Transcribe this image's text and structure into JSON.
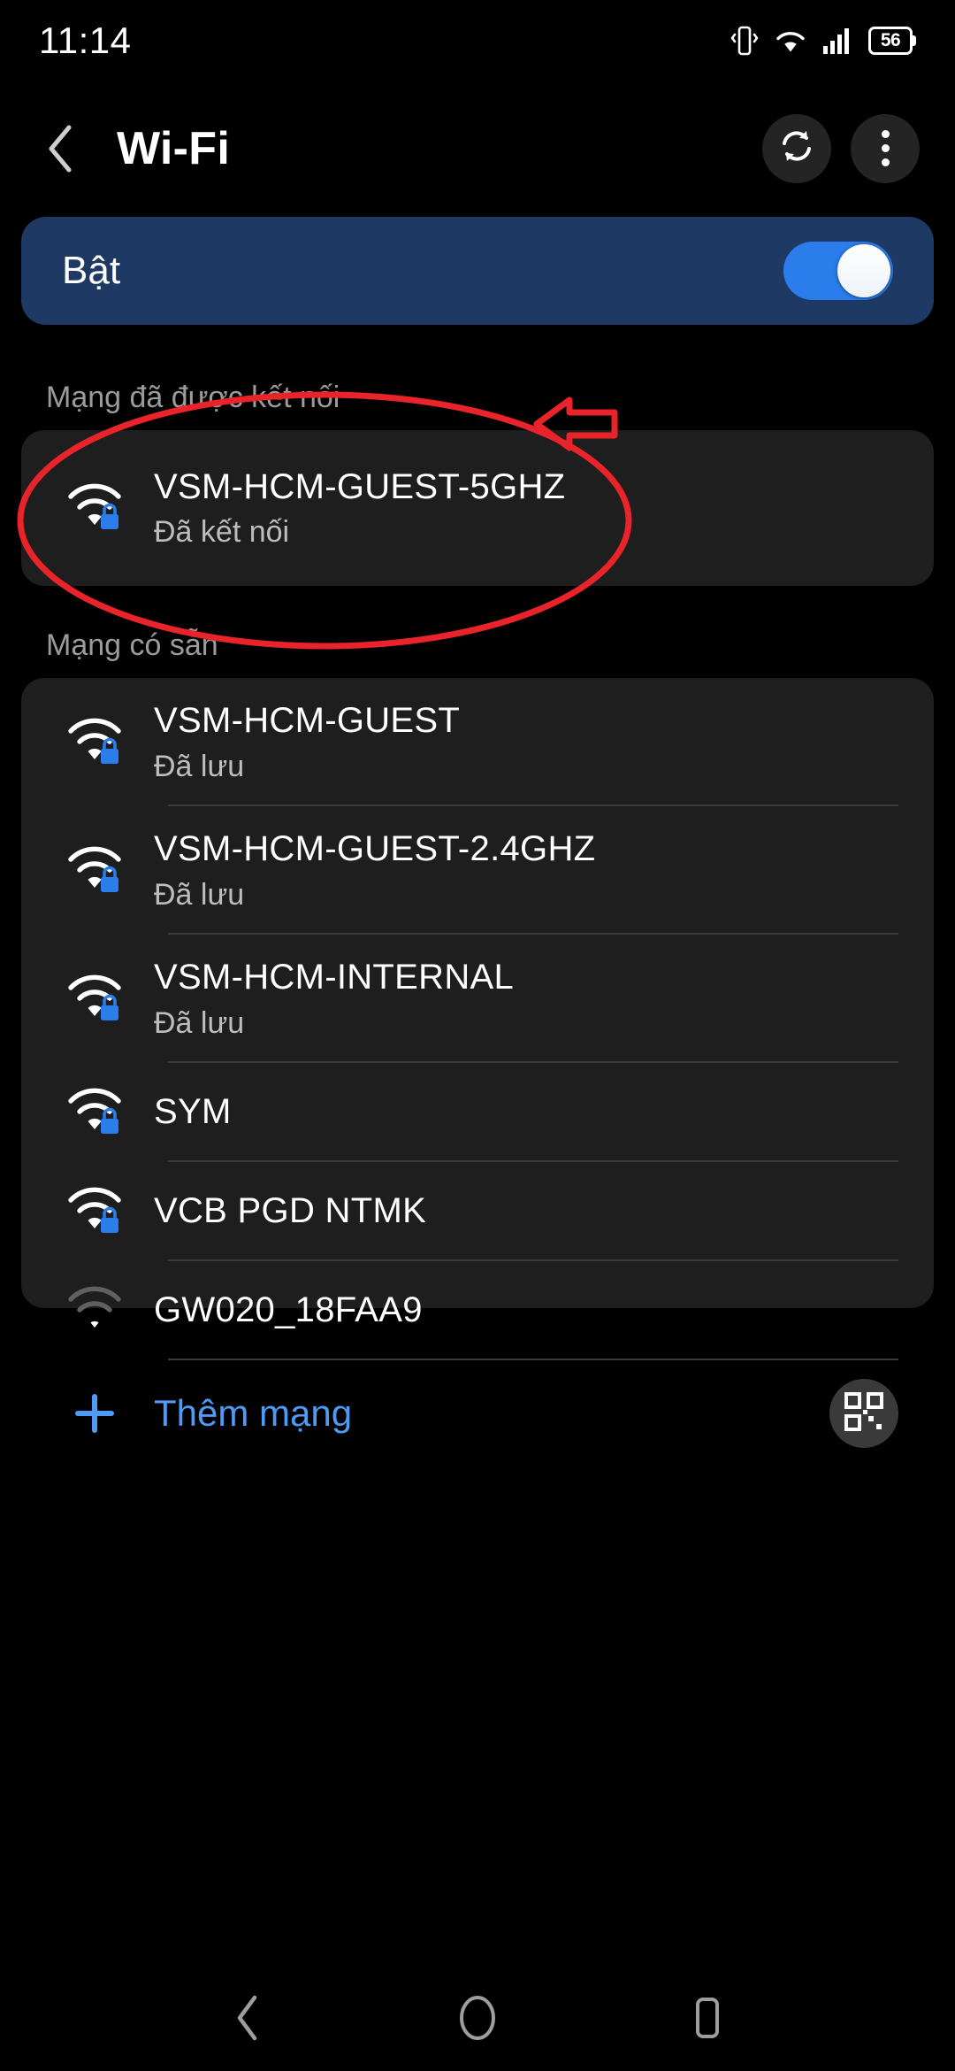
{
  "status_bar": {
    "time": "11:14",
    "battery_level": "56",
    "icons": [
      "vibrate-icon",
      "wifi-icon",
      "cellular-signal-icon",
      "battery-icon"
    ]
  },
  "app_bar": {
    "title": "Wi-Fi",
    "back_icon": "back-chevron-icon",
    "refresh_icon": "refresh-icon",
    "overflow_icon": "overflow-menu-icon"
  },
  "wifi_toggle": {
    "label": "Bật",
    "state": "on",
    "track_color": "#2a7dea",
    "card_color": "#1e3a64"
  },
  "connected_section": {
    "header": "Mạng đã được kết nối",
    "network": {
      "ssid": "VSM-HCM-GUEST-5GHZ",
      "status": "Đã kết nối",
      "secured": true,
      "signal": "full"
    }
  },
  "available_section": {
    "header": "Mạng có sẵn",
    "networks": [
      {
        "ssid": "VSM-HCM-GUEST",
        "status": "Đã lưu",
        "secured": true,
        "signal": "full"
      },
      {
        "ssid": "VSM-HCM-GUEST-2.4GHZ",
        "status": "Đã lưu",
        "secured": true,
        "signal": "full"
      },
      {
        "ssid": "VSM-HCM-INTERNAL",
        "status": "Đã lưu",
        "secured": true,
        "signal": "full"
      },
      {
        "ssid": "SYM",
        "status": "",
        "secured": true,
        "signal": "full"
      },
      {
        "ssid": "VCB PGD NTMK",
        "status": "",
        "secured": true,
        "signal": "full"
      },
      {
        "ssid": "GW020_18FAA9",
        "status": "",
        "secured": false,
        "signal": "weak"
      }
    ]
  },
  "add_network": {
    "label": "Thêm mạng",
    "plus_icon": "plus-icon",
    "qr_icon": "qr-code-icon",
    "accent_color": "#4d9bf5"
  },
  "annotation": {
    "type": "red-ellipse-and-arrow",
    "color": "#e8232a",
    "target": "VSM-HCM-GUEST-5GHZ"
  },
  "nav_bar": {
    "back_label": "back-nav-icon",
    "home_label": "home-nav-icon",
    "recents_label": "recents-nav-icon"
  }
}
